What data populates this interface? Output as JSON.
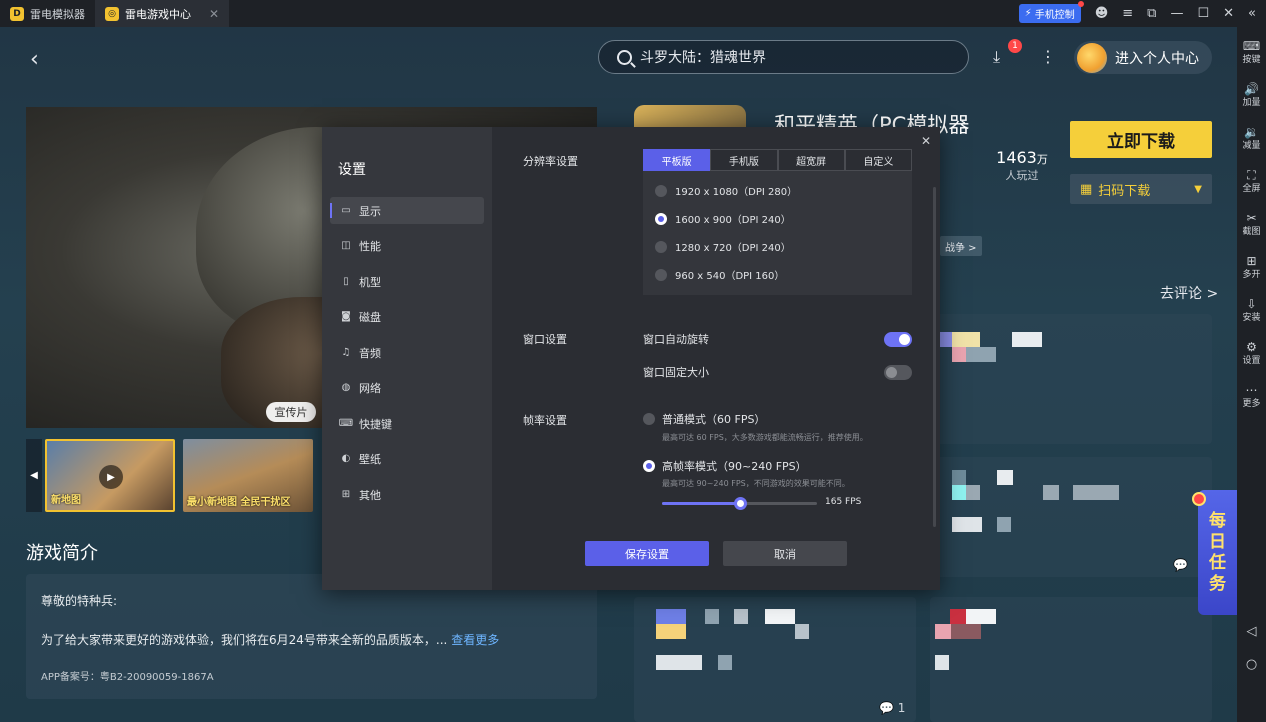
{
  "tabs": [
    {
      "label": "雷电模拟器",
      "active": false
    },
    {
      "label": "雷电游戏中心",
      "active": true
    }
  ],
  "titlebar": {
    "phone_control": "手机控制"
  },
  "sidebar": {
    "items": [
      {
        "icon": "keyboard-icon",
        "label": "按键"
      },
      {
        "icon": "volume-up-icon",
        "label": "加量"
      },
      {
        "icon": "volume-down-icon",
        "label": "减量"
      },
      {
        "icon": "fullscreen-icon",
        "label": "全屏"
      },
      {
        "icon": "scissors-icon",
        "label": "截图"
      },
      {
        "icon": "multi-open-icon",
        "label": "多开"
      },
      {
        "icon": "install-icon",
        "label": "安装"
      },
      {
        "icon": "gear-icon",
        "label": "设置"
      },
      {
        "icon": "more-icon",
        "label": "更多"
      }
    ]
  },
  "header": {
    "search_text": "斗罗大陆：猎魂世界",
    "download_badge": "1",
    "profile_label": "进入个人中心"
  },
  "video": {
    "promo_tag": "宣传片",
    "thumb1_caption": "新地图",
    "thumb2_caption": "最小新地图 全民干扰区"
  },
  "intro": {
    "title": "游戏简介",
    "line1": "尊敬的特种兵:",
    "line2": "为了给大家带来更好的游戏体验，我们将在6月24号带来全新的品质版本，...",
    "more": "查看更多",
    "line3": "APP备案号：粤B2-20090059-1867A"
  },
  "game": {
    "title": "和平精英（PC模拟器",
    "players_num": "1463",
    "players_unit_suffix": "万",
    "players_label": "人玩过",
    "download_btn": "立即下载",
    "qr_btn": "扫码下载",
    "tag": "战争 >",
    "comment_link": "去评论 >",
    "bubble_count": "1",
    "daily_task": [
      "每",
      "日",
      "任",
      "务"
    ]
  },
  "dialog": {
    "title": "设置",
    "nav": [
      {
        "label": "显示",
        "icon": "monitor-icon",
        "active": true
      },
      {
        "label": "性能",
        "icon": "performance-icon",
        "active": false
      },
      {
        "label": "机型",
        "icon": "device-icon",
        "active": false
      },
      {
        "label": "磁盘",
        "icon": "disk-icon",
        "active": false
      },
      {
        "label": "音频",
        "icon": "audio-icon",
        "active": false
      },
      {
        "label": "网络",
        "icon": "globe-icon",
        "active": false
      },
      {
        "label": "快捷键",
        "icon": "shortcut-icon",
        "active": false
      },
      {
        "label": "壁纸",
        "icon": "palette-icon",
        "active": false
      },
      {
        "label": "其他",
        "icon": "grid-icon",
        "active": false
      }
    ],
    "resolution_label": "分辨率设置",
    "resolution_tabs": [
      {
        "label": "平板版",
        "active": true
      },
      {
        "label": "手机版",
        "active": false
      },
      {
        "label": "超宽屏",
        "active": false
      },
      {
        "label": "自定义",
        "active": false
      }
    ],
    "resolutions": [
      {
        "label": "1920 x 1080（DPI 280）",
        "selected": false
      },
      {
        "label": "1600 x 900（DPI 240）",
        "selected": true
      },
      {
        "label": "1280 x 720（DPI 240）",
        "selected": false
      },
      {
        "label": "960 x 540（DPI 160）",
        "selected": false
      }
    ],
    "window_label": "窗口设置",
    "window_options": [
      {
        "label": "窗口自动旋转",
        "on": true
      },
      {
        "label": "窗口固定大小",
        "on": false
      }
    ],
    "fps_label": "帧率设置",
    "fps_modes": [
      {
        "label": "普通模式（60 FPS）",
        "desc": "最高可达 60 FPS，大多数游戏都能流畅运行，推荐使用。",
        "selected": false
      },
      {
        "label": "高帧率模式（90~240 FPS）",
        "desc": "最高可达 90~240 FPS，不同游戏的效果可能不同。",
        "selected": true
      }
    ],
    "fps_slider": {
      "min": 90,
      "max": 240,
      "value": 165
    },
    "fps_value_text": "165 FPS",
    "save": "保存设置",
    "cancel": "取消"
  },
  "colors": {
    "accent": "#5b60e8",
    "download": "#f5cf3a",
    "badge": "#ff4848"
  }
}
